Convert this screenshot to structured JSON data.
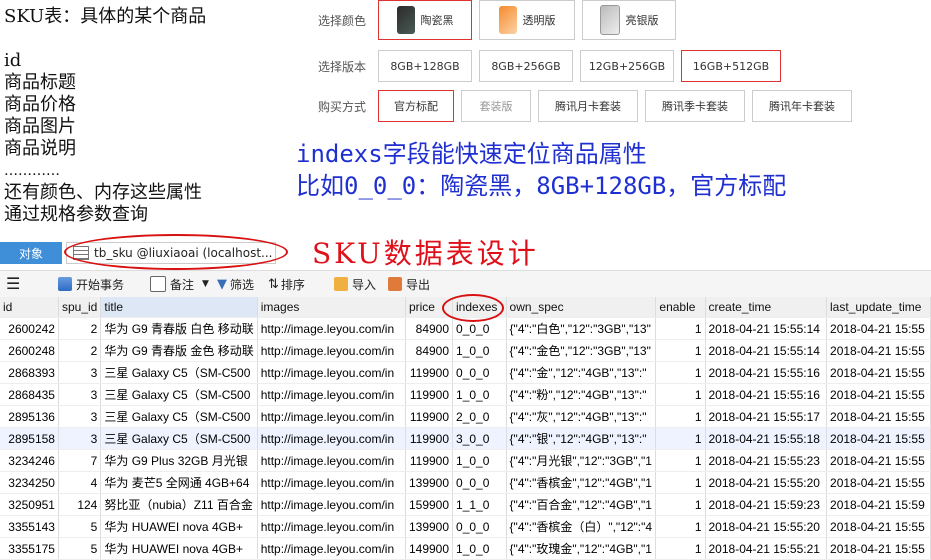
{
  "notes": {
    "title": "SKU表：具体的某个商品",
    "fields": [
      "id",
      "商品标题",
      "商品价格",
      "商品图片",
      "商品说明",
      "…………"
    ],
    "extra": [
      "还有颜色、内存这些属性",
      "通过规格参数查询"
    ]
  },
  "options": {
    "color_label": "选择颜色",
    "colors": [
      "陶瓷黑",
      "透明版",
      "亮银版"
    ],
    "version_label": "选择版本",
    "versions": [
      "8GB+128GB",
      "8GB+256GB",
      "12GB+256GB",
      "16GB+512GB"
    ],
    "buy_label": "购买方式",
    "buy": [
      "官方标配",
      "套装版",
      "腾讯月卡套装",
      "腾讯季卡套装",
      "腾讯年卡套装"
    ]
  },
  "annotation": {
    "line1": "indexs字段能快速定位商品属性",
    "line2": "比如0_0_0：陶瓷黑，8GB+128GB，官方标配"
  },
  "sku_title": "SKU数据表设计",
  "tabs": {
    "objects": "对象",
    "active": "tb_sku @liuxiaoai (localhost..."
  },
  "toolbar": {
    "begin_tx": "开始事务",
    "note": "备注",
    "filter": "筛选",
    "sort": "排序",
    "import": "导入",
    "export": "导出"
  },
  "table": {
    "columns": [
      "id",
      "spu_id",
      "title",
      "images",
      "price",
      "indexes",
      "own_spec",
      "enable",
      "create_time",
      "last_update_time"
    ],
    "rows": [
      [
        "2600242",
        "2",
        "华为 G9 青春版 白色 移动联",
        "http://image.leyou.com/in",
        "84900",
        "0_0_0",
        "{\"4\":\"白色\",\"12\":\"3GB\",\"13\"",
        "1",
        "2018-04-21 15:55:14",
        "2018-04-21 15:55"
      ],
      [
        "2600248",
        "2",
        "华为 G9 青春版 金色 移动联",
        "http://image.leyou.com/in",
        "84900",
        "1_0_0",
        "{\"4\":\"金色\",\"12\":\"3GB\",\"13\"",
        "1",
        "2018-04-21 15:55:14",
        "2018-04-21 15:55"
      ],
      [
        "2868393",
        "3",
        "三星 Galaxy C5（SM-C500",
        "http://image.leyou.com/in",
        "119900",
        "0_0_0",
        "{\"4\":\"金\",\"12\":\"4GB\",\"13\":\"",
        "1",
        "2018-04-21 15:55:16",
        "2018-04-21 15:55"
      ],
      [
        "2868435",
        "3",
        "三星 Galaxy C5（SM-C500",
        "http://image.leyou.com/in",
        "119900",
        "1_0_0",
        "{\"4\":\"粉\",\"12\":\"4GB\",\"13\":\"",
        "1",
        "2018-04-21 15:55:16",
        "2018-04-21 15:55"
      ],
      [
        "2895136",
        "3",
        "三星 Galaxy C5（SM-C500",
        "http://image.leyou.com/in",
        "119900",
        "2_0_0",
        "{\"4\":\"灰\",\"12\":\"4GB\",\"13\":\"",
        "1",
        "2018-04-21 15:55:17",
        "2018-04-21 15:55"
      ],
      [
        "2895158",
        "3",
        "三星 Galaxy C5（SM-C500",
        "http://image.leyou.com/in",
        "119900",
        "3_0_0",
        "{\"4\":\"银\",\"12\":\"4GB\",\"13\":\"",
        "1",
        "2018-04-21 15:55:18",
        "2018-04-21 15:55"
      ],
      [
        "3234246",
        "7",
        "华为 G9 Plus 32GB 月光银",
        "http://image.leyou.com/in",
        "119900",
        "1_0_0",
        "{\"4\":\"月光银\",\"12\":\"3GB\",\"1",
        "1",
        "2018-04-21 15:55:23",
        "2018-04-21 15:55"
      ],
      [
        "3234250",
        "4",
        "华为 麦芒5 全网通 4GB+64",
        "http://image.leyou.com/in",
        "139900",
        "0_0_0",
        "{\"4\":\"香槟金\",\"12\":\"4GB\",\"1",
        "1",
        "2018-04-21 15:55:20",
        "2018-04-21 15:55"
      ],
      [
        "3250951",
        "124",
        "努比亚（nubia）Z11 百合金",
        "http://image.leyou.com/in",
        "159900",
        "1_1_0",
        "{\"4\":\"百合金\",\"12\":\"4GB\",\"1",
        "1",
        "2018-04-21 15:59:23",
        "2018-04-21 15:59"
      ],
      [
        "3355143",
        "5",
        "华为 HUAWEI nova 4GB+",
        "http://image.leyou.com/in",
        "139900",
        "0_0_0",
        "{\"4\":\"香槟金（白）\",\"12\":\"4",
        "1",
        "2018-04-21 15:55:20",
        "2018-04-21 15:55"
      ],
      [
        "3355175",
        "5",
        "华为 HUAWEI nova 4GB+",
        "http://image.leyou.com/in",
        "149900",
        "1_0_0",
        "{\"4\":\"玫瑰金\",\"12\":\"4GB\",\"1",
        "1",
        "2018-04-21 15:55:21",
        "2018-04-21 15:55"
      ]
    ]
  }
}
